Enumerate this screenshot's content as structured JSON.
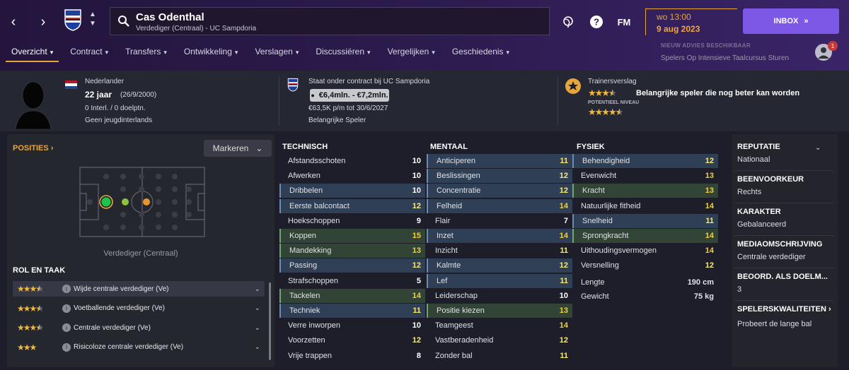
{
  "header": {
    "player_name": "Cas Odenthal",
    "player_sub": "Verdediger (Centraal) - UC Sampdoria",
    "fm_label": "FM",
    "time": "wo 13:00",
    "date": "9 aug 2023",
    "inbox_label": "INBOX",
    "advice_head": "NIEUW ADVIES BESCHIKBAAR",
    "advice_text": "Spelers Op Intensieve Taalcursus Sturen",
    "advice_count": "1"
  },
  "tabs": [
    {
      "label": "Overzicht",
      "active": true
    },
    {
      "label": "Contract"
    },
    {
      "label": "Transfers"
    },
    {
      "label": "Ontwikkeling"
    },
    {
      "label": "Verslagen"
    },
    {
      "label": "Discussiëren"
    },
    {
      "label": "Vergelijken"
    },
    {
      "label": "Geschiedenis"
    }
  ],
  "profile": {
    "nationality": "Nederlander",
    "age": "22 jaar",
    "birth": "(26/9/2000)",
    "caps": "0 Interl. / 0 doelptn.",
    "youth_caps": "Geen jeugdinterlands",
    "contract_status": "Staat onder contract bij UC Sampdoria",
    "value": "€6,4mln. - €7,2mln.",
    "wage": "€63,5K p/m tot 30/6/2027",
    "squad_status": "Belangrijke Speler",
    "coach_report_title": "Trainersverslag",
    "coach_report_text": "Belangrijke speler die nog beter kan worden",
    "potential_label": "POTENTIEEL NIVEAU",
    "current_ability_stars": 3.5,
    "potential_stars": 4.5
  },
  "positions": {
    "title": "POSITIES",
    "mark_button": "Markeren",
    "position_label": "Verdediger (Centraal)"
  },
  "roles": {
    "title": "ROL EN TAAK",
    "items": [
      {
        "name": "Wijde centrale verdediger (Ve)",
        "stars": 3.5,
        "selected": true
      },
      {
        "name": "Voetballende verdediger (Ve)",
        "stars": 3.5
      },
      {
        "name": "Centrale verdediger (Ve)",
        "stars": 3.5
      },
      {
        "name": "Risicoloze centrale verdediger (Ve)",
        "stars": 3
      }
    ]
  },
  "technical": {
    "title": "TECHNISCH",
    "attrs": [
      {
        "name": "Afstandsschoten",
        "value": "10",
        "hl": ""
      },
      {
        "name": "Afwerken",
        "value": "10",
        "hl": ""
      },
      {
        "name": "Dribbelen",
        "value": "10",
        "hl": "b"
      },
      {
        "name": "Eerste balcontact",
        "value": "12",
        "hl": "b"
      },
      {
        "name": "Hoekschoppen",
        "value": "9",
        "hl": ""
      },
      {
        "name": "Koppen",
        "value": "15",
        "hl": "g"
      },
      {
        "name": "Mandekking",
        "value": "13",
        "hl": "g"
      },
      {
        "name": "Passing",
        "value": "12",
        "hl": "b"
      },
      {
        "name": "Strafschoppen",
        "value": "5",
        "hl": ""
      },
      {
        "name": "Tackelen",
        "value": "14",
        "hl": "g"
      },
      {
        "name": "Techniek",
        "value": "11",
        "hl": "b"
      },
      {
        "name": "Verre inworpen",
        "value": "10",
        "hl": ""
      },
      {
        "name": "Voorzetten",
        "value": "12",
        "hl": ""
      },
      {
        "name": "Vrije trappen",
        "value": "8",
        "hl": ""
      }
    ]
  },
  "mental": {
    "title": "MENTAAL",
    "attrs": [
      {
        "name": "Anticiperen",
        "value": "11",
        "hl": "b"
      },
      {
        "name": "Beslissingen",
        "value": "12",
        "hl": "b"
      },
      {
        "name": "Concentratie",
        "value": "12",
        "hl": "b"
      },
      {
        "name": "Felheid",
        "value": "14",
        "hl": "b"
      },
      {
        "name": "Flair",
        "value": "7",
        "hl": ""
      },
      {
        "name": "Inzet",
        "value": "14",
        "hl": "b"
      },
      {
        "name": "Inzicht",
        "value": "11",
        "hl": ""
      },
      {
        "name": "Kalmte",
        "value": "12",
        "hl": "b"
      },
      {
        "name": "Lef",
        "value": "11",
        "hl": "b"
      },
      {
        "name": "Leiderschap",
        "value": "10",
        "hl": ""
      },
      {
        "name": "Positie kiezen",
        "value": "13",
        "hl": "g"
      },
      {
        "name": "Teamgeest",
        "value": "14",
        "hl": ""
      },
      {
        "name": "Vastberadenheid",
        "value": "12",
        "hl": ""
      },
      {
        "name": "Zonder bal",
        "value": "11",
        "hl": ""
      }
    ]
  },
  "physical": {
    "title": "FYSIEK",
    "attrs": [
      {
        "name": "Behendigheid",
        "value": "12",
        "hl": "b"
      },
      {
        "name": "Evenwicht",
        "value": "13",
        "hl": ""
      },
      {
        "name": "Kracht",
        "value": "13",
        "hl": "g"
      },
      {
        "name": "Natuurlijke fitheid",
        "value": "14",
        "hl": ""
      },
      {
        "name": "Snelheid",
        "value": "11",
        "hl": "b"
      },
      {
        "name": "Sprongkracht",
        "value": "14",
        "hl": "g"
      },
      {
        "name": "Uithoudingsvermogen",
        "value": "14",
        "hl": ""
      },
      {
        "name": "Versnelling",
        "value": "12",
        "hl": ""
      }
    ],
    "height_label": "Lengte",
    "height_value": "190 cm",
    "weight_label": "Gewicht",
    "weight_value": "75 kg"
  },
  "right": [
    {
      "head": "REPUTATIE",
      "value": "Nationaal"
    },
    {
      "head": "BEENVOORKEUR",
      "value": "Rechts"
    },
    {
      "head": "KARAKTER",
      "value": "Gebalanceerd"
    },
    {
      "head": "MEDIAOMSCHRIJVING",
      "value": "Centrale verdediger"
    },
    {
      "head": "BEOORD. ALS DOELM...",
      "value": "3"
    },
    {
      "head": "SPELERSKWALITEITEN",
      "value": "Probeert de lange bal"
    }
  ],
  "colors": {
    "accent": "#e7a63a",
    "purple": "#7d58e6",
    "star": "#f1b93b"
  }
}
